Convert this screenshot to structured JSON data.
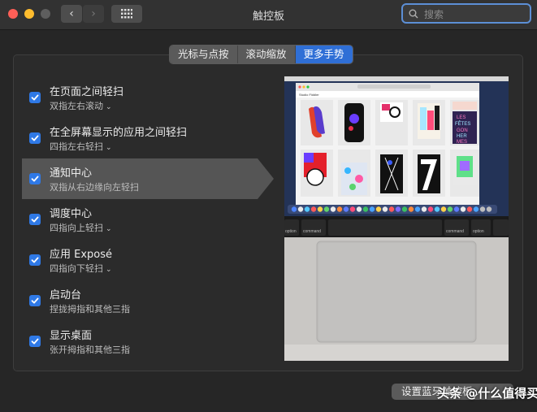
{
  "window": {
    "title": "触控板"
  },
  "search": {
    "placeholder": "搜索"
  },
  "tabs": [
    {
      "label": "光标与点按"
    },
    {
      "label": "滚动缩放"
    },
    {
      "label": "更多手势"
    }
  ],
  "gestures": [
    {
      "title": "在页面之间轻扫",
      "subtitle": "双指左右滚动",
      "has_dropdown": true,
      "checked": true
    },
    {
      "title": "在全屏幕显示的应用之间轻扫",
      "subtitle": "四指左右轻扫",
      "has_dropdown": true,
      "checked": true
    },
    {
      "title": "通知中心",
      "subtitle": "双指从右边缘向左轻扫",
      "has_dropdown": false,
      "checked": true
    },
    {
      "title": "调度中心",
      "subtitle": "四指向上轻扫",
      "has_dropdown": true,
      "checked": true
    },
    {
      "title": "应用 Exposé",
      "subtitle": "四指向下轻扫",
      "has_dropdown": true,
      "checked": true
    },
    {
      "title": "启动台",
      "subtitle": "捏拢拇指和其他三指",
      "has_dropdown": false,
      "checked": true
    },
    {
      "title": "显示桌面",
      "subtitle": "张开拇指和其他三指",
      "has_dropdown": false,
      "checked": true
    }
  ],
  "preview": {
    "browser_title": "Studio Fiddler",
    "keys": {
      "command_left": "command",
      "option_left": "option",
      "command_right": "command",
      "option_right": "option"
    },
    "poster_text": [
      "LES",
      "FÊTES",
      "GON",
      "HER",
      "MES"
    ]
  },
  "bottom_button": {
    "label": "设置蓝牙触控板…"
  },
  "watermark": {
    "text": "头条 @什么值得买"
  },
  "colors": {
    "accent": "#2f79e6",
    "tab_active": "#2f6fd6",
    "selected_row": "#555555"
  }
}
